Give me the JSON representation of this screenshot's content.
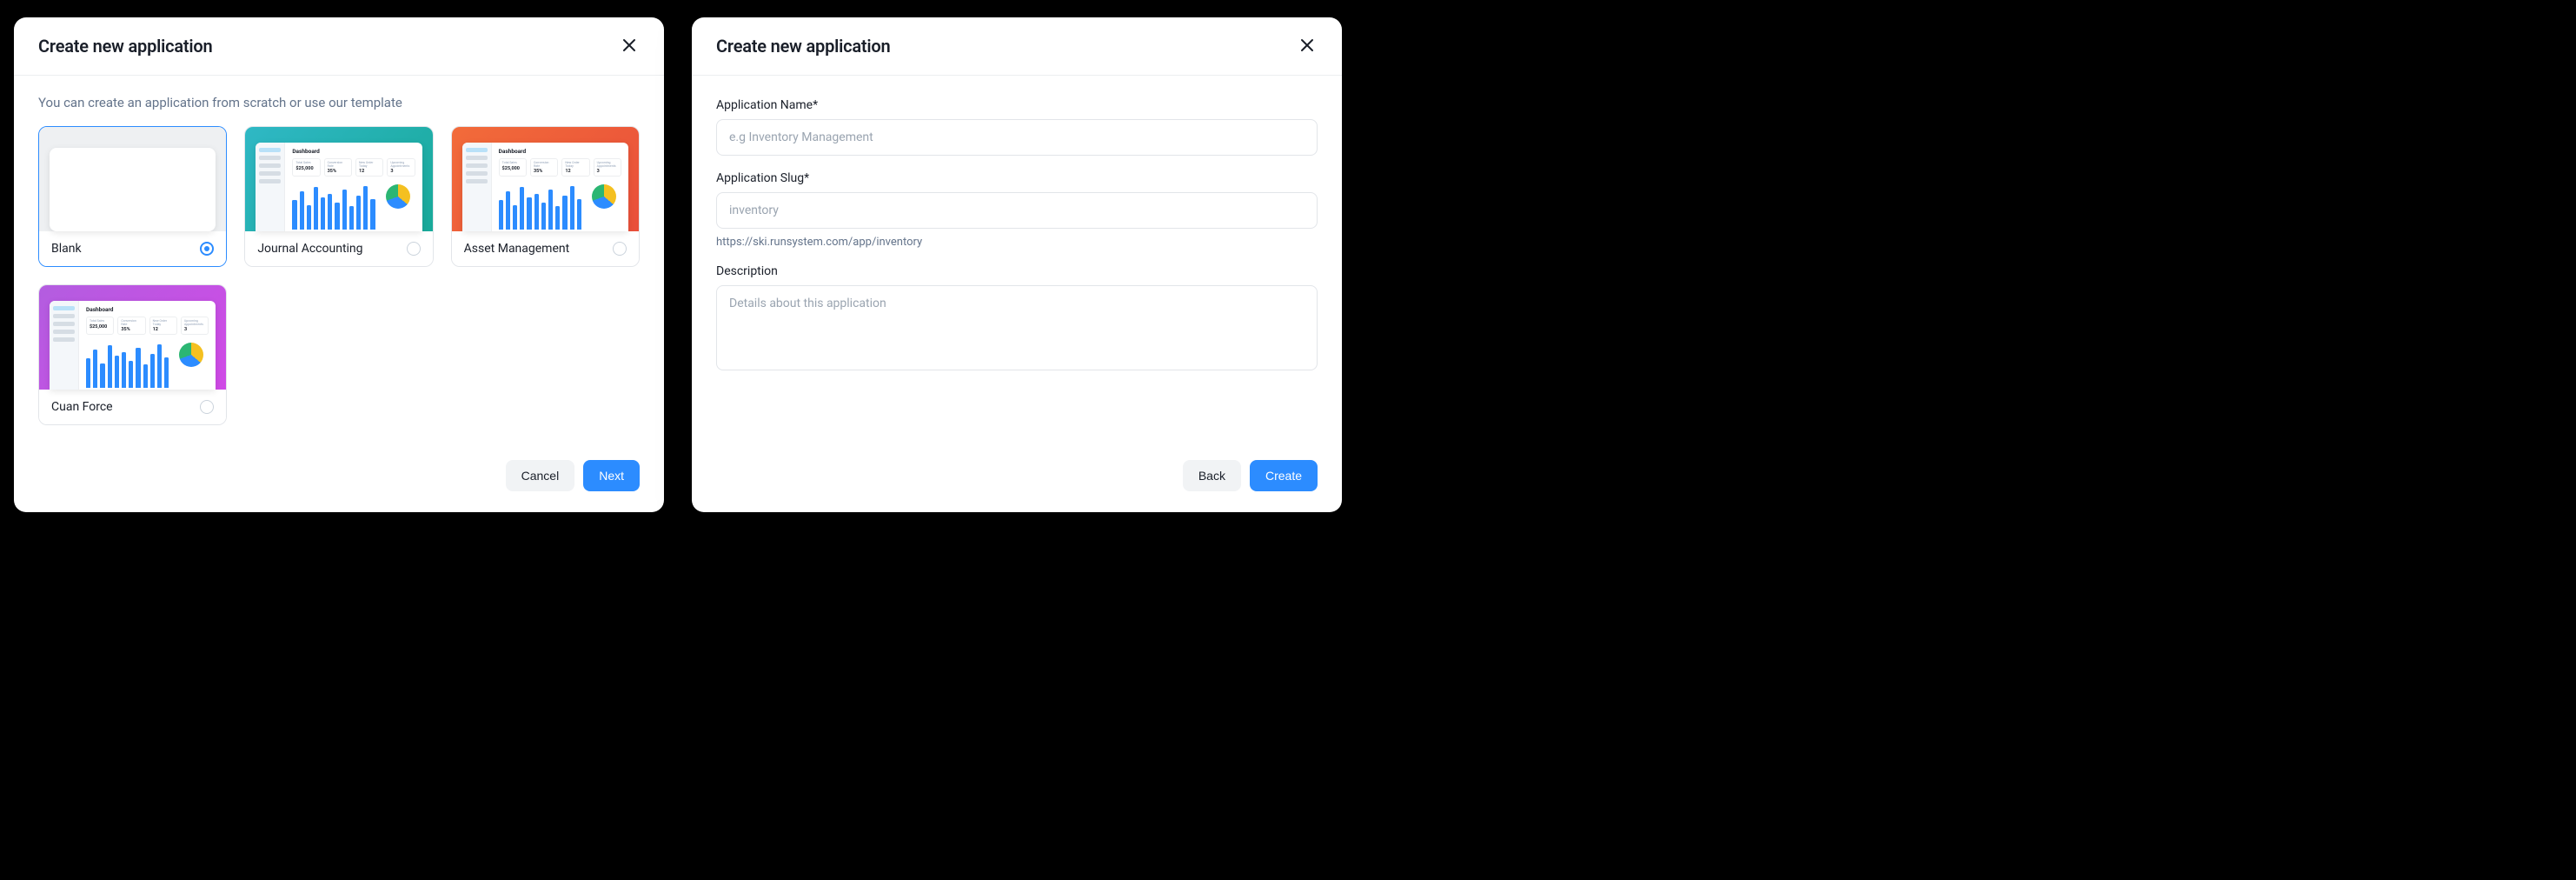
{
  "modal1": {
    "title": "Create new application",
    "subtitle": "You can create an application from scratch or use our template",
    "cancel_label": "Cancel",
    "next_label": "Next",
    "templates": [
      {
        "label": "Blank",
        "selected": true,
        "variant": "blank"
      },
      {
        "label": "Journal Accounting",
        "selected": false,
        "variant": "teal"
      },
      {
        "label": "Asset Management",
        "selected": false,
        "variant": "orange"
      },
      {
        "label": "Cuan Force",
        "selected": false,
        "variant": "purple"
      }
    ],
    "dashboard_preview": {
      "heading": "Dashboard",
      "stats": [
        {
          "label": "Total Sales",
          "value": "$25,000"
        },
        {
          "label": "Conversion Rate",
          "value": "35%"
        },
        {
          "label": "New Order Today",
          "value": "12"
        },
        {
          "label": "Upcoming Appointments",
          "value": "3"
        }
      ]
    }
  },
  "modal2": {
    "title": "Create new application",
    "name_label": "Application Name*",
    "name_placeholder": "e.g Inventory Management",
    "slug_label": "Application Slug*",
    "slug_placeholder": "inventory",
    "slug_help": "https://ski.runsystem.com/app/inventory",
    "desc_label": "Description",
    "desc_placeholder": "Details about this application",
    "back_label": "Back",
    "create_label": "Create"
  },
  "icons": {
    "close": "close-icon"
  }
}
